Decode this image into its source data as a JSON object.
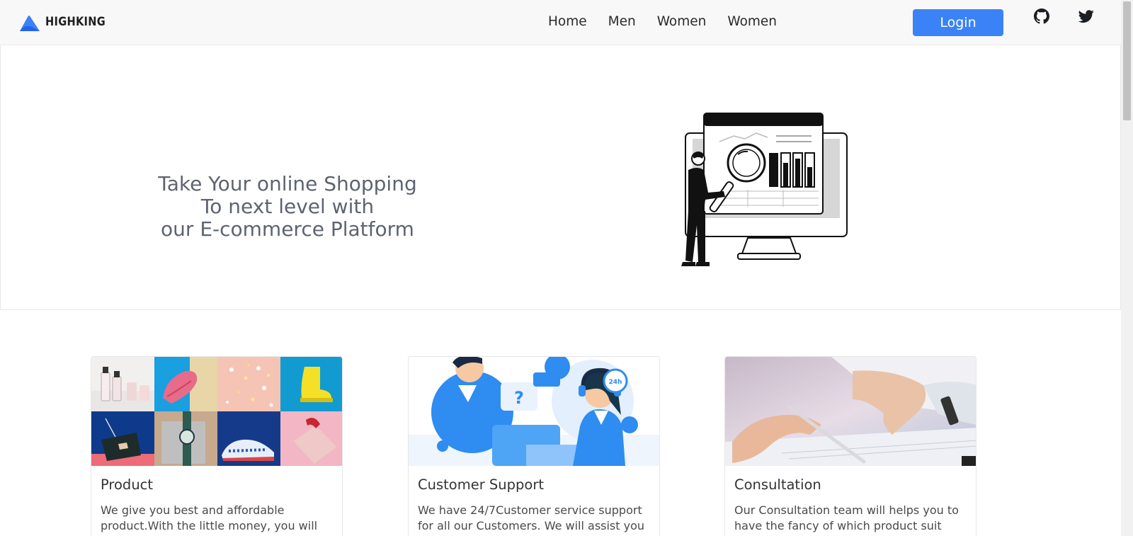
{
  "brand": {
    "name": "HIGHKING",
    "logo_color": "#3b82f6"
  },
  "nav": {
    "links": [
      {
        "label": "Home"
      },
      {
        "label": "Men"
      },
      {
        "label": "Women"
      },
      {
        "label": "Women"
      }
    ],
    "login_label": "Login",
    "icons": [
      "github-icon",
      "twitter-icon"
    ]
  },
  "hero": {
    "lines": [
      "Take Your online Shopping",
      "To next level with",
      "our E-commerce Platform"
    ],
    "illustration": "analytics-magnifier-illustration"
  },
  "cards": [
    {
      "title": "Product",
      "text": "We give you best and affordable product.With the little money, you will get",
      "image": "product-collage"
    },
    {
      "title": "Customer Support",
      "text": "We have 24/7Customer service support for all our Customers. We will assist you",
      "image": "customer-support-illustration",
      "image_badge": "24h"
    },
    {
      "title": "Consultation",
      "text": "Our Consultation team will helps you to have the fancy of which product suit",
      "image": "consultation-photo"
    }
  ],
  "colors": {
    "accent": "#3b82f6",
    "hero_text": "#5d6470",
    "navbar_bg": "#f8f8f8"
  }
}
